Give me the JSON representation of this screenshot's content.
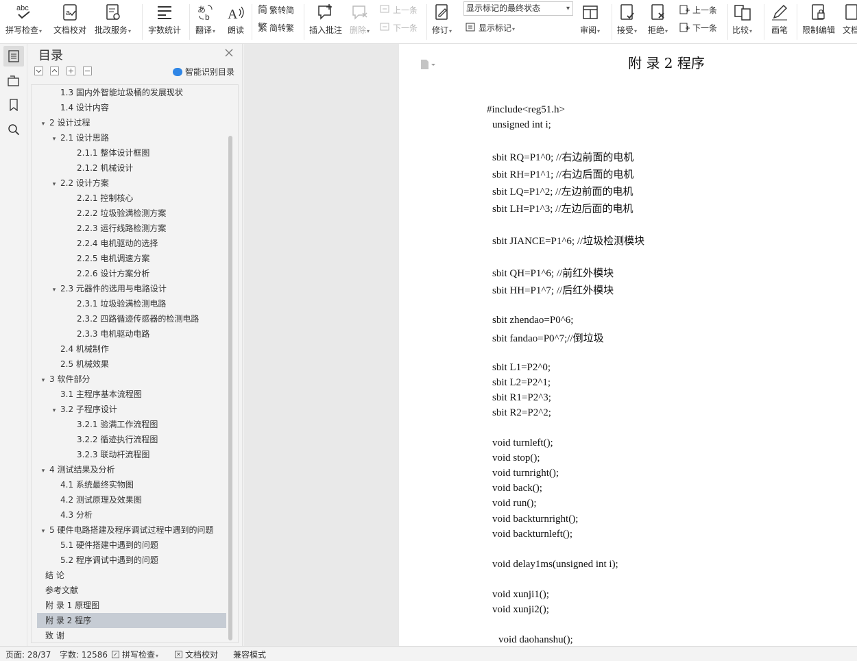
{
  "ribbon": {
    "spellcheck": "拼写检查",
    "doc_proof": "文档校对",
    "batch_service": "批改服务",
    "word_count": "字数统计",
    "translate": "翻译",
    "read_aloud": "朗读",
    "trad_to_simp": "繁转简",
    "simp_to_trad": "简转繁",
    "insert_comment": "插入批注",
    "delete": "删除",
    "prev_comment": "上一条",
    "next_comment": "下一条",
    "track_changes": "修订",
    "markup_select": "显示标记的最终状态",
    "show_markup": "显示标记",
    "review": "审阅",
    "accept": "接受",
    "reject": "拒绝",
    "prev_change": "上一条",
    "next_change": "下一条",
    "compare": "比较",
    "pen": "画笔",
    "restrict_edit": "限制编辑",
    "doc_permission": "文档"
  },
  "toc": {
    "title": "目录",
    "smart_label": "智能识别目录",
    "items": [
      {
        "text": "1.3 国内外智能垃圾桶的发展现状",
        "level": 2
      },
      {
        "text": "1.4 设计内容",
        "level": 2
      },
      {
        "text": "2   设计过程",
        "level": 1,
        "expanded": true
      },
      {
        "text": "2.1 设计思路",
        "level": 2,
        "expanded": true
      },
      {
        "text": "2.1.1 整体设计框图",
        "level": 3
      },
      {
        "text": "2.1.2 机械设计",
        "level": 3
      },
      {
        "text": "2.2 设计方案",
        "level": 2,
        "expanded": true
      },
      {
        "text": "2.2.1 控制核心",
        "level": 3
      },
      {
        "text": "2.2.2 垃圾验满检测方案",
        "level": 3
      },
      {
        "text": "2.2.3 运行线路检测方案",
        "level": 3
      },
      {
        "text": "2.2.4 电机驱动的选择",
        "level": 3
      },
      {
        "text": "2.2.5 电机调速方案",
        "level": 3
      },
      {
        "text": "2.2.6 设计方案分析",
        "level": 3
      },
      {
        "text": "2.3 元器件的选用与电路设计",
        "level": 2,
        "expanded": true
      },
      {
        "text": "2.3.1 垃圾验满检测电路",
        "level": 3
      },
      {
        "text": "2.3.2 四路循迹传感器的检测电路",
        "level": 3
      },
      {
        "text": "2.3.3 电机驱动电路",
        "level": 3
      },
      {
        "text": "2.4 机械制作",
        "level": 2
      },
      {
        "text": "2.5 机械效果",
        "level": 2
      },
      {
        "text": "3   软件部分",
        "level": 1,
        "expanded": true
      },
      {
        "text": "3.1 主程序基本流程图",
        "level": 2
      },
      {
        "text": "3.2 子程序设计",
        "level": 2,
        "expanded": true
      },
      {
        "text": "3.2.1 验满工作流程图",
        "level": 3
      },
      {
        "text": "3.2.2 循迹执行流程图",
        "level": 3
      },
      {
        "text": "3.2.3 联动杆流程图",
        "level": 3
      },
      {
        "text": "4   测试结果及分析",
        "level": 1,
        "expanded": true
      },
      {
        "text": "4.1 系统最终实物图",
        "level": 2
      },
      {
        "text": "4.2 测试原理及效果图",
        "level": 2
      },
      {
        "text": "4.3 分析",
        "level": 2
      },
      {
        "text": "5   硬件电路搭建及程序调试过程中遇到的问题",
        "level": 1,
        "expanded": true
      },
      {
        "text": "5.1 硬件搭建中遇到的问题",
        "level": 2
      },
      {
        "text": "5.2 程序调试中遇到的问题",
        "level": 2
      },
      {
        "text": "结    论",
        "level": 0
      },
      {
        "text": "参考文献",
        "level": 0
      },
      {
        "text": "附  录 1  原理图",
        "level": 0
      },
      {
        "text": "附  录 2  程序",
        "level": 0,
        "selected": true
      },
      {
        "text": "致    谢",
        "level": 0
      }
    ]
  },
  "document": {
    "title": "附    录 2  程序",
    "code_lines": [
      "#include<reg51.h>",
      "unsigned int i;",
      "sbit RQ=P1^0; //右边前面的电机",
      "sbit RH=P1^1; //右边后面的电机",
      "sbit LQ=P1^2; //左边前面的电机",
      "sbit LH=P1^3; //左边后面的电机",
      "sbit JIANCE=P1^6; //垃圾检测模块",
      "sbit QH=P1^6; //前红外模块",
      "sbit HH=P1^7; //后红外模块",
      "sbit zhendao=P0^6;",
      "sbit fandao=P0^7;//倒垃圾",
      "sbit L1=P2^0;",
      "sbit L2=P2^1;",
      "sbit R1=P2^3;",
      "sbit R2=P2^2;",
      "void turnleft();",
      "void stop();",
      "void turnright();",
      "void back();",
      "void run();",
      "void backturnright();",
      "void backturnleft();",
      "void delay1ms(unsigned int i);",
      "void xunji1();",
      "void xunji2();",
      "void daohanshu();"
    ]
  },
  "status": {
    "page": "页面: 28/37",
    "words": "字数: 12586",
    "spellcheck": "拼写检查",
    "doc_proof": "文档校对",
    "compat_mode": "兼容模式"
  },
  "colors": {
    "accent_blue": "#2f86e6",
    "selected_row": "#c6ccd4",
    "spell_underline": "#d22222"
  }
}
